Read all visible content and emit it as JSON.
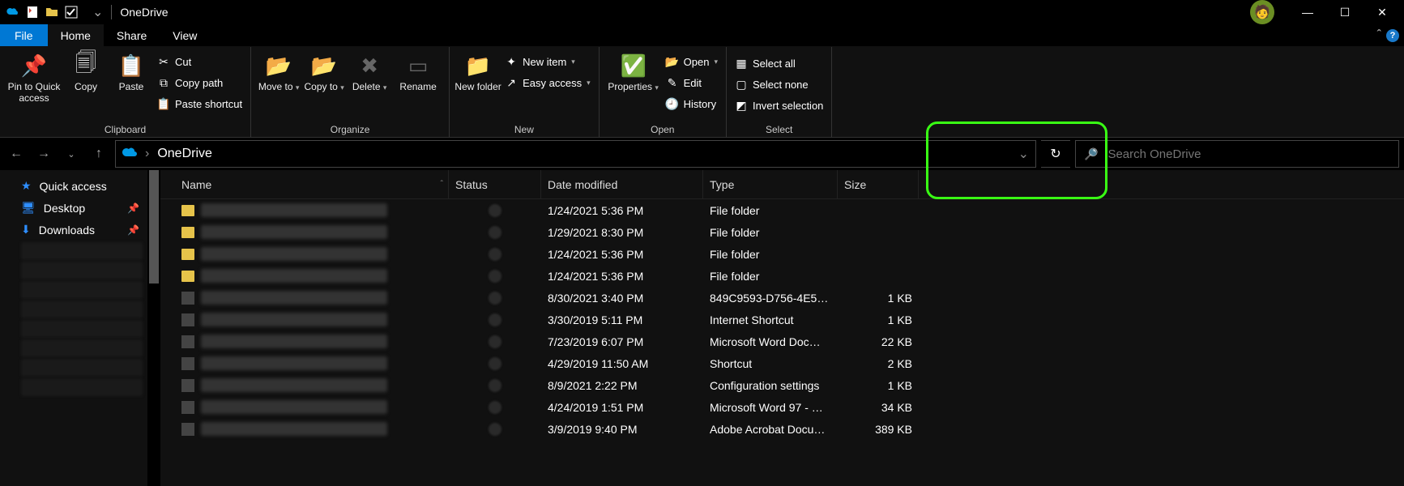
{
  "title": "OneDrive",
  "tabs": {
    "file": "File",
    "home": "Home",
    "share": "Share",
    "view": "View"
  },
  "ribbon": {
    "clipboard": {
      "label": "Clipboard",
      "pin": "Pin to Quick access",
      "copy": "Copy",
      "paste": "Paste",
      "cut": "Cut",
      "copypath": "Copy path",
      "pasteshortcut": "Paste shortcut"
    },
    "organize": {
      "label": "Organize",
      "moveto": "Move to",
      "copyto": "Copy to",
      "delete": "Delete",
      "rename": "Rename"
    },
    "new": {
      "label": "New",
      "newfolder": "New folder",
      "newitem": "New item",
      "easyaccess": "Easy access"
    },
    "open": {
      "label": "Open",
      "properties": "Properties",
      "open": "Open",
      "edit": "Edit",
      "history": "History"
    },
    "select": {
      "label": "Select",
      "all": "Select all",
      "none": "Select none",
      "invert": "Invert selection"
    }
  },
  "breadcrumb": "OneDrive",
  "search_placeholder": "Search OneDrive",
  "sidebar": {
    "quick": "Quick access",
    "desktop": "Desktop",
    "downloads": "Downloads"
  },
  "columns": {
    "name": "Name",
    "status": "Status",
    "date": "Date modified",
    "type": "Type",
    "size": "Size"
  },
  "rows": [
    {
      "date": "1/24/2021 5:36 PM",
      "type": "File folder",
      "size": "",
      "folder": true
    },
    {
      "date": "1/29/2021 8:30 PM",
      "type": "File folder",
      "size": "",
      "folder": true
    },
    {
      "date": "1/24/2021 5:36 PM",
      "type": "File folder",
      "size": "",
      "folder": true
    },
    {
      "date": "1/24/2021 5:36 PM",
      "type": "File folder",
      "size": "",
      "folder": true
    },
    {
      "date": "8/30/2021 3:40 PM",
      "type": "849C9593-D756-4E5…",
      "size": "1 KB",
      "folder": false
    },
    {
      "date": "3/30/2019 5:11 PM",
      "type": "Internet Shortcut",
      "size": "1 KB",
      "folder": false
    },
    {
      "date": "7/23/2019 6:07 PM",
      "type": "Microsoft Word Doc…",
      "size": "22 KB",
      "folder": false
    },
    {
      "date": "4/29/2019 11:50 AM",
      "type": "Shortcut",
      "size": "2 KB",
      "folder": false
    },
    {
      "date": "8/9/2021 2:22 PM",
      "type": "Configuration settings",
      "size": "1 KB",
      "folder": false
    },
    {
      "date": "4/24/2019 1:51 PM",
      "type": "Microsoft Word 97 - …",
      "size": "34 KB",
      "folder": false
    },
    {
      "date": "3/9/2019 9:40 PM",
      "type": "Adobe Acrobat Docu…",
      "size": "389 KB",
      "folder": false
    }
  ]
}
